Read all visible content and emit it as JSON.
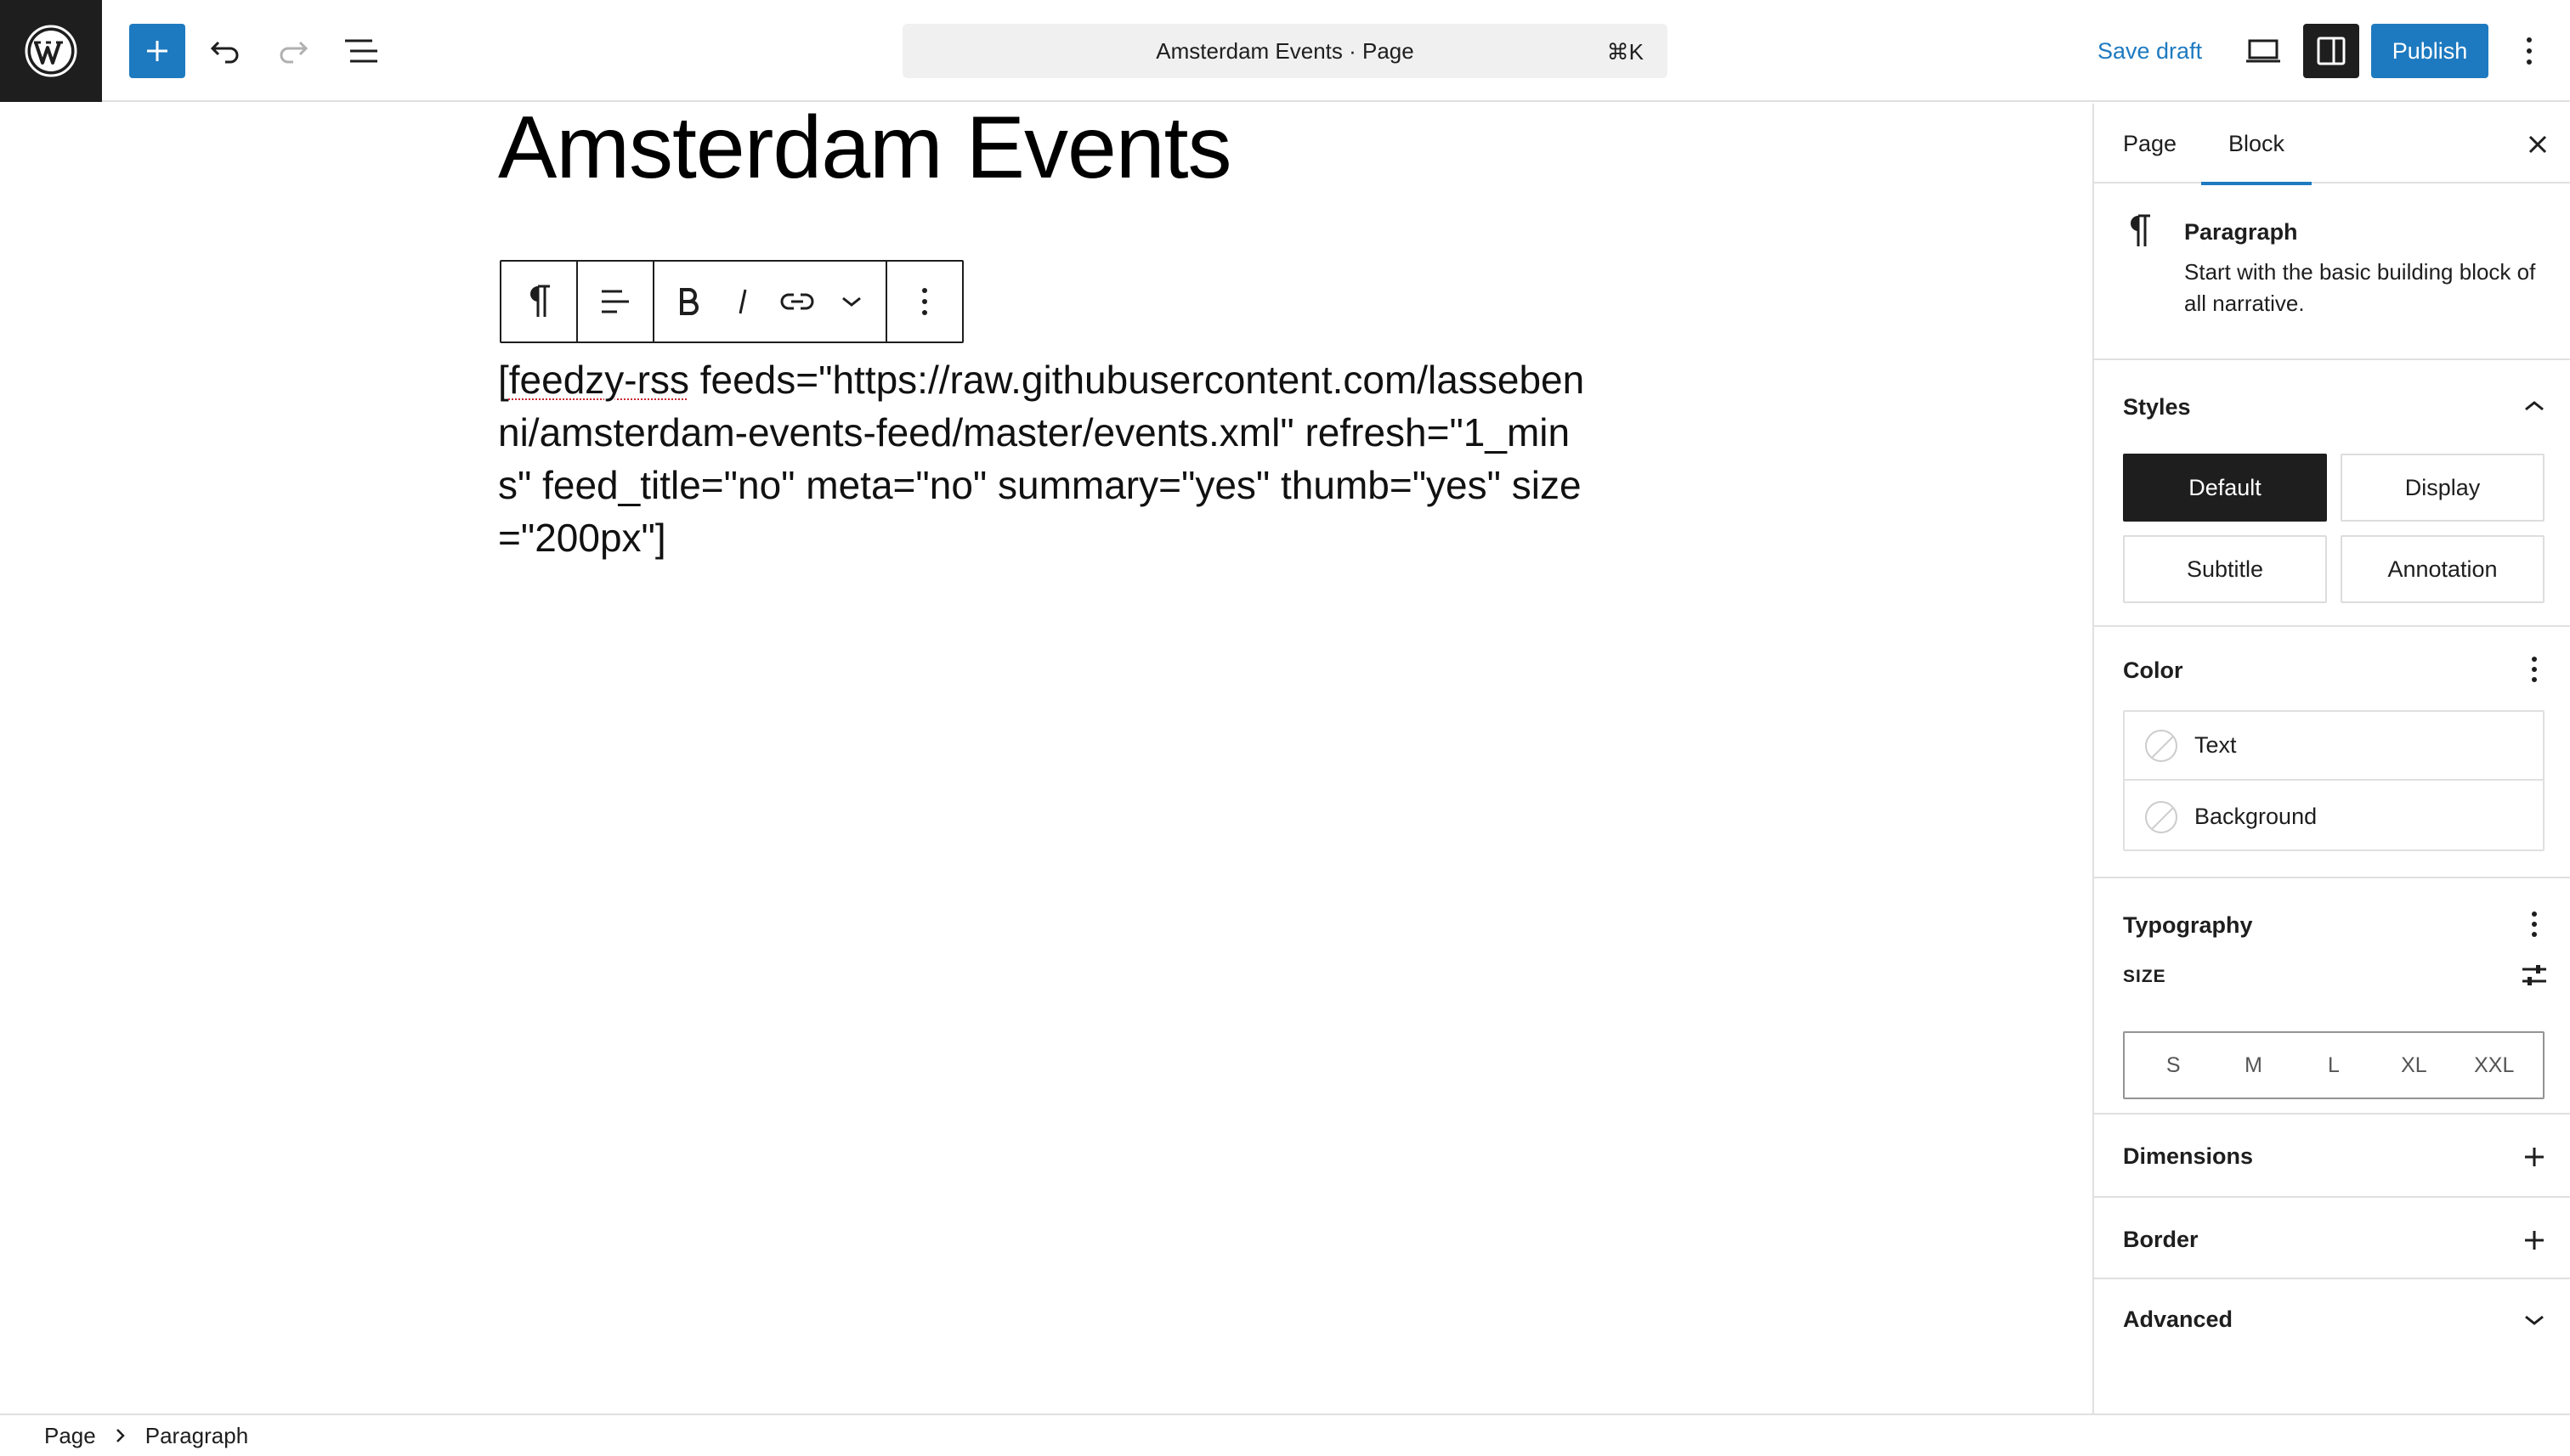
{
  "app": {
    "icons": {
      "logo": "wordpress-logo",
      "add": "plus-icon",
      "undo": "undo-icon",
      "redo": "redo-icon",
      "list_view": "list-view-icon",
      "preview": "desktop-preview-icon",
      "settings": "sidebar-toggle-icon",
      "options": "more-vertical-icon"
    },
    "accent_color": "#1e7ac0"
  },
  "header": {
    "document_title": "Amsterdam Events · Page",
    "shortcut": "⌘K",
    "save_draft": "Save draft",
    "publish": "Publish"
  },
  "editor": {
    "title": "Amsterdam Events",
    "paragraph_prefix": "[",
    "paragraph_flagged": "feedzy-rss",
    "paragraph_rest": " feeds=\"https://raw.githubusercontent.com/lassebenni/amsterdam-events-feed/master/events.xml\" refresh=\"1_mins\" feed_title=\"no\" meta=\"no\" summary=\"yes\" thumb=\"yes\" size=\"200px\"]",
    "toolbar": {
      "icons": [
        "paragraph-icon",
        "align-icon",
        "bold-icon",
        "italic-icon",
        "link-icon",
        "chevron-down-icon",
        "more-vertical-icon"
      ]
    }
  },
  "sidebar": {
    "tabs": [
      {
        "label": "Page",
        "active": false
      },
      {
        "label": "Block",
        "active": true
      }
    ],
    "block": {
      "name": "Paragraph",
      "description": "Start with the basic building block of all narrative."
    },
    "styles": {
      "title": "Styles",
      "options": [
        {
          "label": "Default",
          "selected": true
        },
        {
          "label": "Display",
          "selected": false
        },
        {
          "label": "Subtitle",
          "selected": false
        },
        {
          "label": "Annotation",
          "selected": false
        }
      ]
    },
    "color": {
      "title": "Color",
      "items": [
        "Text",
        "Background"
      ]
    },
    "typography": {
      "title": "Typography",
      "size_label": "SIZE",
      "sizes": [
        "S",
        "M",
        "L",
        "XL",
        "XXL"
      ]
    },
    "dimensions": {
      "title": "Dimensions"
    },
    "border": {
      "title": "Border"
    },
    "advanced": {
      "title": "Advanced"
    }
  },
  "footer": {
    "breadcrumbs": [
      "Page",
      "Paragraph"
    ]
  }
}
